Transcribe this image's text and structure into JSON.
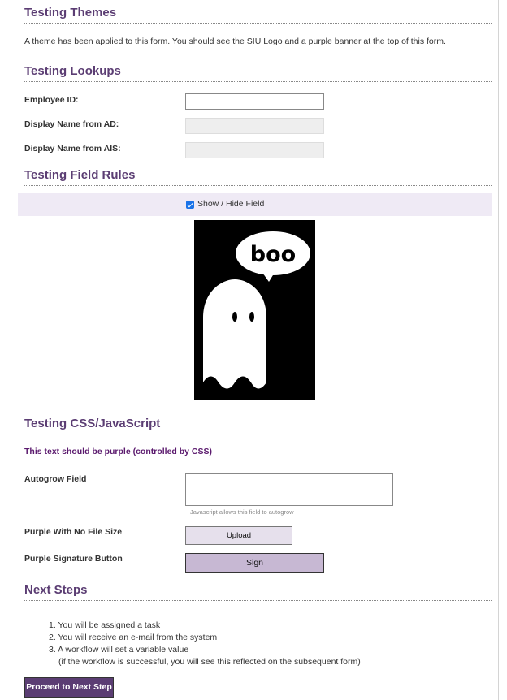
{
  "sections": {
    "themes": {
      "title": "Testing Themes",
      "description": "A theme has been applied to this form. You should see the SIU Logo and a purple banner at the top of this form."
    },
    "lookups": {
      "title": "Testing Lookups",
      "employee_id_label": "Employee ID:",
      "employee_id_value": "",
      "display_name_ad_label": "Display Name from AD:",
      "display_name_ad_value": "",
      "display_name_ais_label": "Display Name from AIS:",
      "display_name_ais_value": ""
    },
    "field_rules": {
      "title": "Testing Field Rules",
      "toggle_label": "Show / Hide Field",
      "toggle_checked": true,
      "ghost_text": "boo"
    },
    "css_js": {
      "title": "Testing CSS/JavaScript",
      "purple_text": "This text should be purple (controlled by CSS)",
      "autogrow_label": "Autogrow Field",
      "autogrow_value": "",
      "autogrow_hint": "Javascript allows this field to autogrow",
      "upload_label": "Purple With No File Size",
      "upload_button": "Upload",
      "signature_label": "Purple Signature Button",
      "sign_button": "Sign"
    },
    "next_steps": {
      "title": "Next Steps",
      "items": [
        "1. You will be assigned a task",
        "2. You will receive an e-mail from the system",
        "3. A workflow will set a variable value"
      ],
      "note": "(if the workflow is successful, you will see this reflected on the subsequent form)",
      "proceed_button": "Proceed to Next Step"
    }
  },
  "colors": {
    "accent": "#5b3d73",
    "purple_text": "#5b1a6e",
    "toggle_row_bg": "#efeaf5",
    "sign_button_bg": "#c7b8d3",
    "upload_button_bg": "#e6e0ec"
  }
}
